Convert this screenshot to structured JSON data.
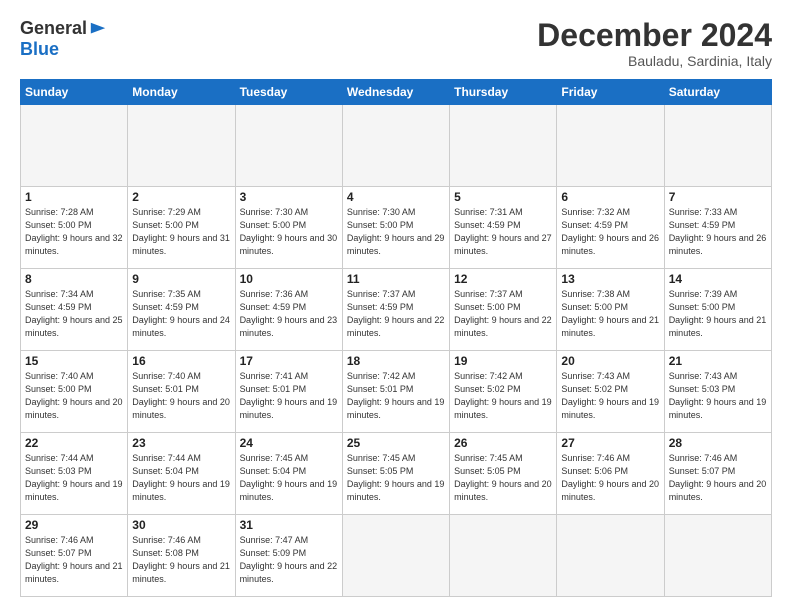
{
  "header": {
    "logo_general": "General",
    "logo_blue": "Blue",
    "month_title": "December 2024",
    "location": "Bauladu, Sardinia, Italy"
  },
  "calendar": {
    "days_of_week": [
      "Sunday",
      "Monday",
      "Tuesday",
      "Wednesday",
      "Thursday",
      "Friday",
      "Saturday"
    ],
    "weeks": [
      [
        {
          "day": "",
          "empty": true
        },
        {
          "day": "",
          "empty": true
        },
        {
          "day": "",
          "empty": true
        },
        {
          "day": "",
          "empty": true
        },
        {
          "day": "",
          "empty": true
        },
        {
          "day": "",
          "empty": true
        },
        {
          "day": "",
          "empty": true
        }
      ],
      [
        {
          "day": "1",
          "sunrise": "7:28 AM",
          "sunset": "5:00 PM",
          "daylight": "9 hours and 32 minutes."
        },
        {
          "day": "2",
          "sunrise": "7:29 AM",
          "sunset": "5:00 PM",
          "daylight": "9 hours and 31 minutes."
        },
        {
          "day": "3",
          "sunrise": "7:30 AM",
          "sunset": "5:00 PM",
          "daylight": "9 hours and 30 minutes."
        },
        {
          "day": "4",
          "sunrise": "7:30 AM",
          "sunset": "5:00 PM",
          "daylight": "9 hours and 29 minutes."
        },
        {
          "day": "5",
          "sunrise": "7:31 AM",
          "sunset": "4:59 PM",
          "daylight": "9 hours and 27 minutes."
        },
        {
          "day": "6",
          "sunrise": "7:32 AM",
          "sunset": "4:59 PM",
          "daylight": "9 hours and 26 minutes."
        },
        {
          "day": "7",
          "sunrise": "7:33 AM",
          "sunset": "4:59 PM",
          "daylight": "9 hours and 26 minutes."
        }
      ],
      [
        {
          "day": "8",
          "sunrise": "7:34 AM",
          "sunset": "4:59 PM",
          "daylight": "9 hours and 25 minutes."
        },
        {
          "day": "9",
          "sunrise": "7:35 AM",
          "sunset": "4:59 PM",
          "daylight": "9 hours and 24 minutes."
        },
        {
          "day": "10",
          "sunrise": "7:36 AM",
          "sunset": "4:59 PM",
          "daylight": "9 hours and 23 minutes."
        },
        {
          "day": "11",
          "sunrise": "7:37 AM",
          "sunset": "4:59 PM",
          "daylight": "9 hours and 22 minutes."
        },
        {
          "day": "12",
          "sunrise": "7:37 AM",
          "sunset": "5:00 PM",
          "daylight": "9 hours and 22 minutes."
        },
        {
          "day": "13",
          "sunrise": "7:38 AM",
          "sunset": "5:00 PM",
          "daylight": "9 hours and 21 minutes."
        },
        {
          "day": "14",
          "sunrise": "7:39 AM",
          "sunset": "5:00 PM",
          "daylight": "9 hours and 21 minutes."
        }
      ],
      [
        {
          "day": "15",
          "sunrise": "7:40 AM",
          "sunset": "5:00 PM",
          "daylight": "9 hours and 20 minutes."
        },
        {
          "day": "16",
          "sunrise": "7:40 AM",
          "sunset": "5:01 PM",
          "daylight": "9 hours and 20 minutes."
        },
        {
          "day": "17",
          "sunrise": "7:41 AM",
          "sunset": "5:01 PM",
          "daylight": "9 hours and 19 minutes."
        },
        {
          "day": "18",
          "sunrise": "7:42 AM",
          "sunset": "5:01 PM",
          "daylight": "9 hours and 19 minutes."
        },
        {
          "day": "19",
          "sunrise": "7:42 AM",
          "sunset": "5:02 PM",
          "daylight": "9 hours and 19 minutes."
        },
        {
          "day": "20",
          "sunrise": "7:43 AM",
          "sunset": "5:02 PM",
          "daylight": "9 hours and 19 minutes."
        },
        {
          "day": "21",
          "sunrise": "7:43 AM",
          "sunset": "5:03 PM",
          "daylight": "9 hours and 19 minutes."
        }
      ],
      [
        {
          "day": "22",
          "sunrise": "7:44 AM",
          "sunset": "5:03 PM",
          "daylight": "9 hours and 19 minutes."
        },
        {
          "day": "23",
          "sunrise": "7:44 AM",
          "sunset": "5:04 PM",
          "daylight": "9 hours and 19 minutes."
        },
        {
          "day": "24",
          "sunrise": "7:45 AM",
          "sunset": "5:04 PM",
          "daylight": "9 hours and 19 minutes."
        },
        {
          "day": "25",
          "sunrise": "7:45 AM",
          "sunset": "5:05 PM",
          "daylight": "9 hours and 19 minutes."
        },
        {
          "day": "26",
          "sunrise": "7:45 AM",
          "sunset": "5:05 PM",
          "daylight": "9 hours and 20 minutes."
        },
        {
          "day": "27",
          "sunrise": "7:46 AM",
          "sunset": "5:06 PM",
          "daylight": "9 hours and 20 minutes."
        },
        {
          "day": "28",
          "sunrise": "7:46 AM",
          "sunset": "5:07 PM",
          "daylight": "9 hours and 20 minutes."
        }
      ],
      [
        {
          "day": "29",
          "sunrise": "7:46 AM",
          "sunset": "5:07 PM",
          "daylight": "9 hours and 21 minutes."
        },
        {
          "day": "30",
          "sunrise": "7:46 AM",
          "sunset": "5:08 PM",
          "daylight": "9 hours and 21 minutes."
        },
        {
          "day": "31",
          "sunrise": "7:47 AM",
          "sunset": "5:09 PM",
          "daylight": "9 hours and 22 minutes."
        },
        {
          "day": "",
          "empty": true
        },
        {
          "day": "",
          "empty": true
        },
        {
          "day": "",
          "empty": true
        },
        {
          "day": "",
          "empty": true
        }
      ]
    ]
  }
}
